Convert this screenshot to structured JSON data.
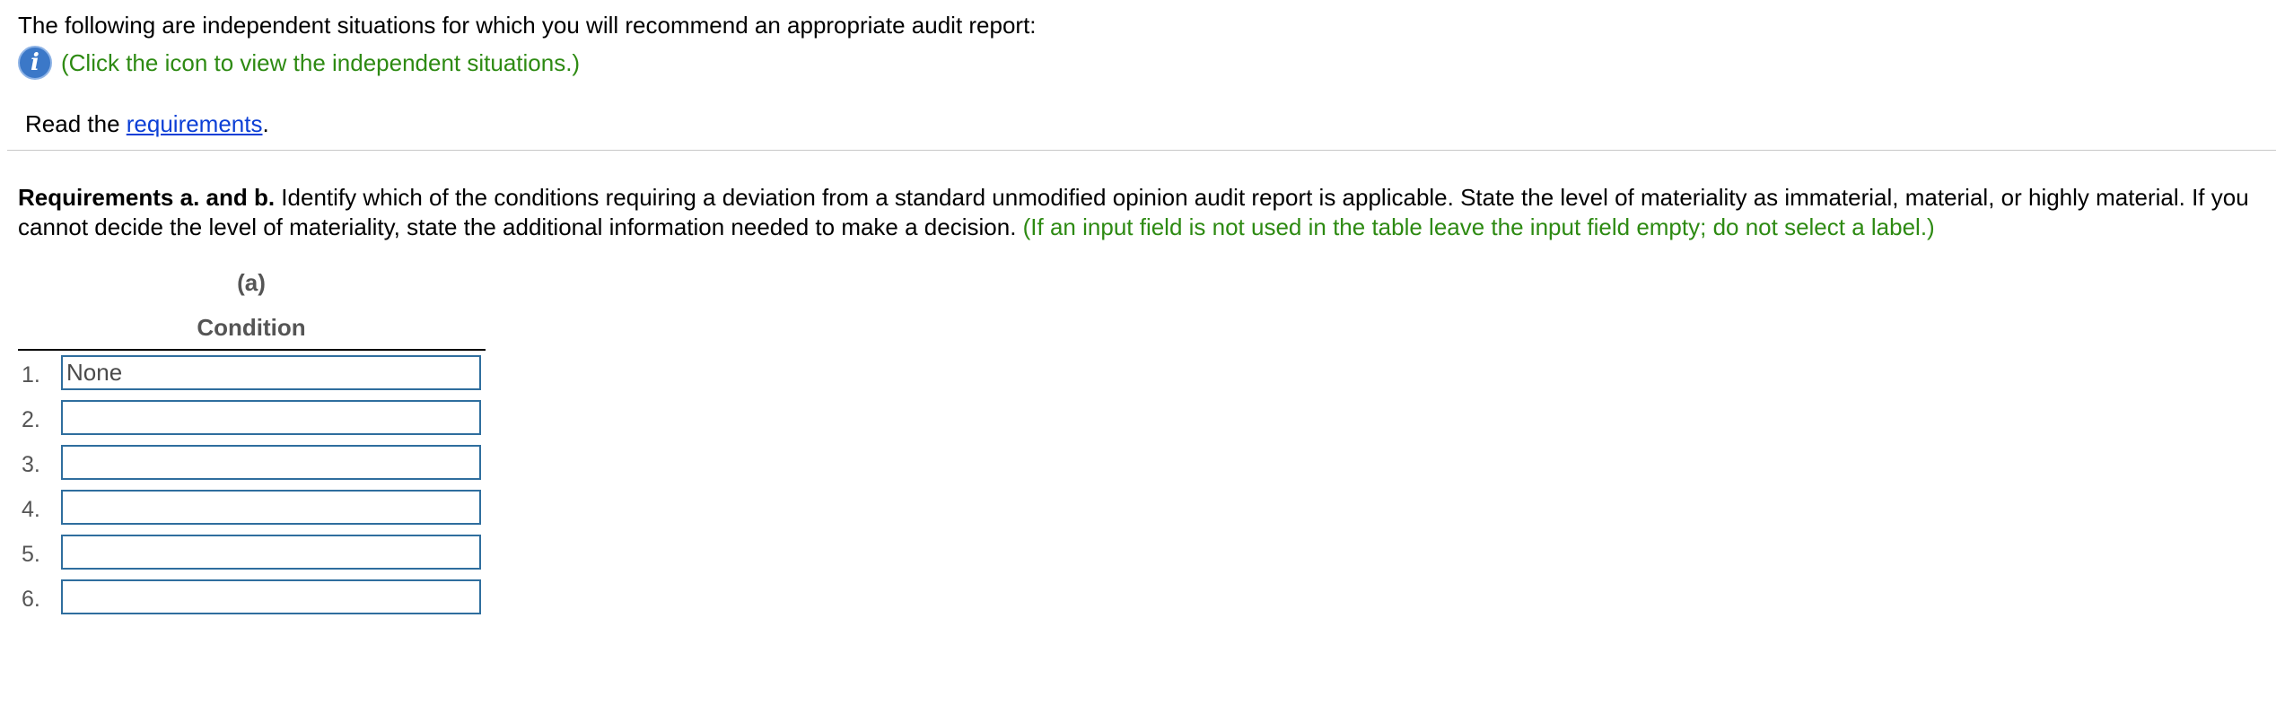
{
  "intro": {
    "text": "The following are independent situations for which you will recommend an appropriate audit report:"
  },
  "info": {
    "icon": "info-icon",
    "icon_glyph": "i",
    "text": "(Click the icon to view the independent situations.)",
    "icon_color": "#3b78c8",
    "text_color": "#2d8a12"
  },
  "read": {
    "prefix": "Read the ",
    "link": "requirements",
    "suffix": "."
  },
  "requirements": {
    "bold_label": "Requirements a. and b.",
    "body": " Identify which of the conditions requiring a deviation from a standard unmodified opinion audit report is applicable. State the level of materiality as immaterial, material, or highly material. If you cannot decide the level of materiality, state the additional information needed to make a decision.",
    "hint": " (If an input field is not used in the table leave the input field empty; do not select a label.)"
  },
  "table": {
    "column_letter": "(a)",
    "column_title": "Condition",
    "rows": [
      {
        "number": "1.",
        "value": "None"
      },
      {
        "number": "2.",
        "value": ""
      },
      {
        "number": "3.",
        "value": ""
      },
      {
        "number": "4.",
        "value": ""
      },
      {
        "number": "5.",
        "value": ""
      },
      {
        "number": "6.",
        "value": ""
      }
    ]
  },
  "colors": {
    "link": "#0b3fd6",
    "input_border": "#2f6e9e",
    "hint_green": "#2d8a12"
  }
}
